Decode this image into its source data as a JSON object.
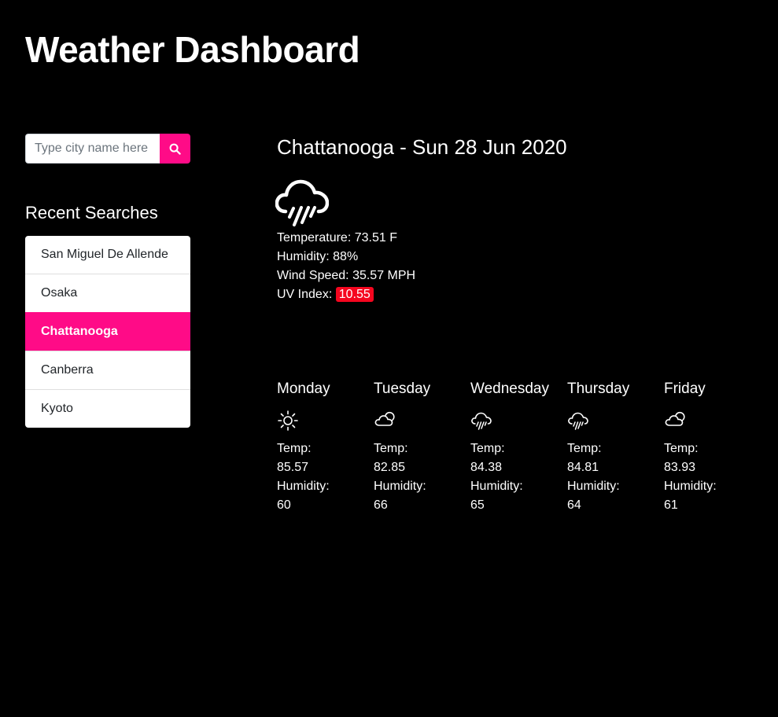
{
  "header": {
    "title": "Weather Dashboard"
  },
  "colors": {
    "accent": "#ff0b87",
    "uv_severe": "#f5061f"
  },
  "search": {
    "placeholder": "Type city name here",
    "icon": "search-icon"
  },
  "recent": {
    "heading": "Recent Searches",
    "items": [
      {
        "label": "San Miguel De Allende",
        "active": false
      },
      {
        "label": "Osaka",
        "active": false
      },
      {
        "label": "Chattanooga",
        "active": true
      },
      {
        "label": "Canberra",
        "active": false
      },
      {
        "label": "Kyoto",
        "active": false
      }
    ]
  },
  "current": {
    "title": "Chattanooga - Sun 28 Jun 2020",
    "icon": "rain-cloud-icon",
    "temperature_label": "Temperature:",
    "temperature_value": "73.51 F",
    "humidity_label": "Humidity:",
    "humidity_value": "88%",
    "wind_label": "Wind Speed:",
    "wind_value": "35.57 MPH",
    "uv_label": "UV Index:",
    "uv_value": "10.55"
  },
  "forecast": [
    {
      "day": "Monday",
      "icon": "sun-icon",
      "temp_label": "Temp:",
      "temp": "85.57",
      "humidity_label": "Humidity:",
      "humidity": "60"
    },
    {
      "day": "Tuesday",
      "icon": "partly-cloudy-icon",
      "temp_label": "Temp:",
      "temp": "82.85",
      "humidity_label": "Humidity:",
      "humidity": "66"
    },
    {
      "day": "Wednesday",
      "icon": "rain-cloud-icon",
      "temp_label": "Temp:",
      "temp": "84.38",
      "humidity_label": "Humidity:",
      "humidity": "65"
    },
    {
      "day": "Thursday",
      "icon": "rain-cloud-icon",
      "temp_label": "Temp:",
      "temp": "84.81",
      "humidity_label": "Humidity:",
      "humidity": "64"
    },
    {
      "day": "Friday",
      "icon": "partly-cloudy-icon",
      "temp_label": "Temp:",
      "temp": "83.93",
      "humidity_label": "Humidity:",
      "humidity": "61"
    }
  ]
}
